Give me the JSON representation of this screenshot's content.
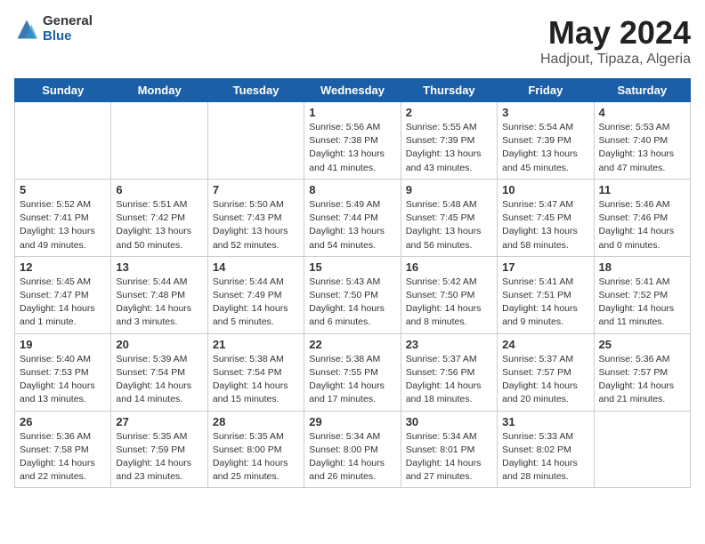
{
  "logo": {
    "general": "General",
    "blue": "Blue"
  },
  "title": {
    "month": "May 2024",
    "location": "Hadjout, Tipaza, Algeria"
  },
  "weekdays": [
    "Sunday",
    "Monday",
    "Tuesday",
    "Wednesday",
    "Thursday",
    "Friday",
    "Saturday"
  ],
  "weeks": [
    [
      {
        "day": "",
        "info": ""
      },
      {
        "day": "",
        "info": ""
      },
      {
        "day": "",
        "info": ""
      },
      {
        "day": "1",
        "info": "Sunrise: 5:56 AM\nSunset: 7:38 PM\nDaylight: 13 hours\nand 41 minutes."
      },
      {
        "day": "2",
        "info": "Sunrise: 5:55 AM\nSunset: 7:39 PM\nDaylight: 13 hours\nand 43 minutes."
      },
      {
        "day": "3",
        "info": "Sunrise: 5:54 AM\nSunset: 7:39 PM\nDaylight: 13 hours\nand 45 minutes."
      },
      {
        "day": "4",
        "info": "Sunrise: 5:53 AM\nSunset: 7:40 PM\nDaylight: 13 hours\nand 47 minutes."
      }
    ],
    [
      {
        "day": "5",
        "info": "Sunrise: 5:52 AM\nSunset: 7:41 PM\nDaylight: 13 hours\nand 49 minutes."
      },
      {
        "day": "6",
        "info": "Sunrise: 5:51 AM\nSunset: 7:42 PM\nDaylight: 13 hours\nand 50 minutes."
      },
      {
        "day": "7",
        "info": "Sunrise: 5:50 AM\nSunset: 7:43 PM\nDaylight: 13 hours\nand 52 minutes."
      },
      {
        "day": "8",
        "info": "Sunrise: 5:49 AM\nSunset: 7:44 PM\nDaylight: 13 hours\nand 54 minutes."
      },
      {
        "day": "9",
        "info": "Sunrise: 5:48 AM\nSunset: 7:45 PM\nDaylight: 13 hours\nand 56 minutes."
      },
      {
        "day": "10",
        "info": "Sunrise: 5:47 AM\nSunset: 7:45 PM\nDaylight: 13 hours\nand 58 minutes."
      },
      {
        "day": "11",
        "info": "Sunrise: 5:46 AM\nSunset: 7:46 PM\nDaylight: 14 hours\nand 0 minutes."
      }
    ],
    [
      {
        "day": "12",
        "info": "Sunrise: 5:45 AM\nSunset: 7:47 PM\nDaylight: 14 hours\nand 1 minute."
      },
      {
        "day": "13",
        "info": "Sunrise: 5:44 AM\nSunset: 7:48 PM\nDaylight: 14 hours\nand 3 minutes."
      },
      {
        "day": "14",
        "info": "Sunrise: 5:44 AM\nSunset: 7:49 PM\nDaylight: 14 hours\nand 5 minutes."
      },
      {
        "day": "15",
        "info": "Sunrise: 5:43 AM\nSunset: 7:50 PM\nDaylight: 14 hours\nand 6 minutes."
      },
      {
        "day": "16",
        "info": "Sunrise: 5:42 AM\nSunset: 7:50 PM\nDaylight: 14 hours\nand 8 minutes."
      },
      {
        "day": "17",
        "info": "Sunrise: 5:41 AM\nSunset: 7:51 PM\nDaylight: 14 hours\nand 9 minutes."
      },
      {
        "day": "18",
        "info": "Sunrise: 5:41 AM\nSunset: 7:52 PM\nDaylight: 14 hours\nand 11 minutes."
      }
    ],
    [
      {
        "day": "19",
        "info": "Sunrise: 5:40 AM\nSunset: 7:53 PM\nDaylight: 14 hours\nand 13 minutes."
      },
      {
        "day": "20",
        "info": "Sunrise: 5:39 AM\nSunset: 7:54 PM\nDaylight: 14 hours\nand 14 minutes."
      },
      {
        "day": "21",
        "info": "Sunrise: 5:38 AM\nSunset: 7:54 PM\nDaylight: 14 hours\nand 15 minutes."
      },
      {
        "day": "22",
        "info": "Sunrise: 5:38 AM\nSunset: 7:55 PM\nDaylight: 14 hours\nand 17 minutes."
      },
      {
        "day": "23",
        "info": "Sunrise: 5:37 AM\nSunset: 7:56 PM\nDaylight: 14 hours\nand 18 minutes."
      },
      {
        "day": "24",
        "info": "Sunrise: 5:37 AM\nSunset: 7:57 PM\nDaylight: 14 hours\nand 20 minutes."
      },
      {
        "day": "25",
        "info": "Sunrise: 5:36 AM\nSunset: 7:57 PM\nDaylight: 14 hours\nand 21 minutes."
      }
    ],
    [
      {
        "day": "26",
        "info": "Sunrise: 5:36 AM\nSunset: 7:58 PM\nDaylight: 14 hours\nand 22 minutes."
      },
      {
        "day": "27",
        "info": "Sunrise: 5:35 AM\nSunset: 7:59 PM\nDaylight: 14 hours\nand 23 minutes."
      },
      {
        "day": "28",
        "info": "Sunrise: 5:35 AM\nSunset: 8:00 PM\nDaylight: 14 hours\nand 25 minutes."
      },
      {
        "day": "29",
        "info": "Sunrise: 5:34 AM\nSunset: 8:00 PM\nDaylight: 14 hours\nand 26 minutes."
      },
      {
        "day": "30",
        "info": "Sunrise: 5:34 AM\nSunset: 8:01 PM\nDaylight: 14 hours\nand 27 minutes."
      },
      {
        "day": "31",
        "info": "Sunrise: 5:33 AM\nSunset: 8:02 PM\nDaylight: 14 hours\nand 28 minutes."
      },
      {
        "day": "",
        "info": ""
      }
    ]
  ]
}
